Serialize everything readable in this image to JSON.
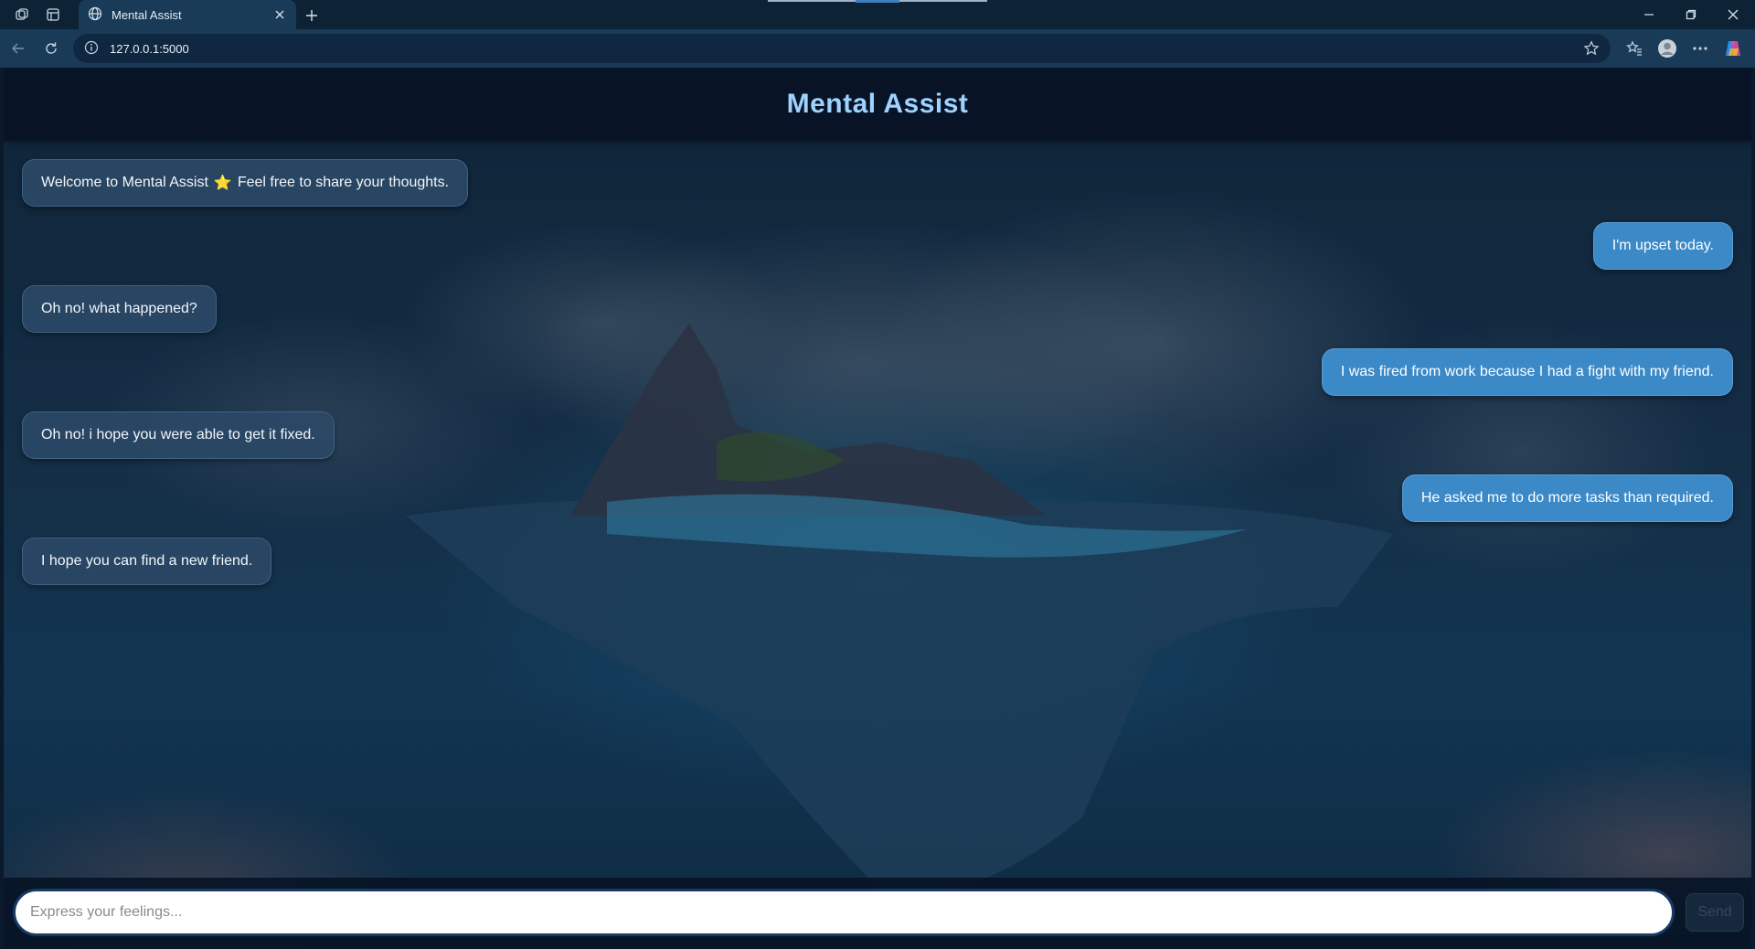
{
  "browser": {
    "tab_title": "Mental Assist",
    "url": "127.0.0.1:5000"
  },
  "app": {
    "title": "Mental Assist"
  },
  "messages": [
    {
      "role": "bot",
      "text_before": "Welcome to Mental Assist",
      "emoji": "⭐",
      "text_after": "Feel free to share your thoughts."
    },
    {
      "role": "user",
      "text": "I'm upset today."
    },
    {
      "role": "bot",
      "text": "Oh no! what happened?"
    },
    {
      "role": "user",
      "text": "I was fired from work because I had a fight with my friend."
    },
    {
      "role": "bot",
      "text": "Oh no! i hope you were able to get it fixed."
    },
    {
      "role": "user",
      "text": "He asked me to do more tasks than required."
    },
    {
      "role": "bot",
      "text": "I hope you can find a new friend."
    }
  ],
  "composer": {
    "placeholder": "Express your feelings...",
    "send_label": "Send"
  },
  "colors": {
    "title": "#9fd2ff",
    "user_bubble": "#3b89c7",
    "bot_bubble": "#2a4866"
  }
}
